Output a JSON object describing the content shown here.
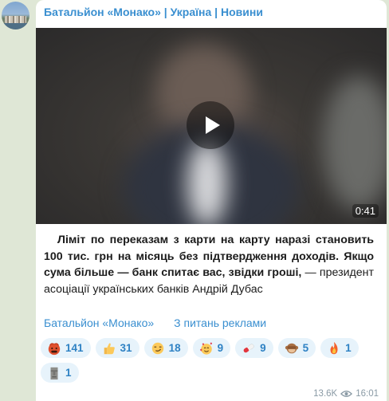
{
  "channel": {
    "title": "Батальйон «Монако» | Україна | Новини"
  },
  "video": {
    "duration": "0:41"
  },
  "post": {
    "caption_bold": "Ліміт по переказам з карти на карту наразі становить 100 тис. грн на місяць без підтвердження доходів. Якщо сума більше — банк спитає вас, звідки гроші,",
    "caption_rest": " — президент асоціації українських банків Андрій Дубас"
  },
  "links": {
    "channel_link": "Батальйон «Монако»",
    "ads_link": "З питань реклами"
  },
  "reactions": [
    {
      "icon": "angry-face-icon",
      "count": "141"
    },
    {
      "icon": "thumbs-up-icon",
      "count": "31"
    },
    {
      "icon": "smirking-face-icon",
      "count": "18"
    },
    {
      "icon": "hearts-face-icon",
      "count": "9"
    },
    {
      "icon": "pill-icon",
      "count": "9"
    },
    {
      "icon": "see-no-evil-monkey-icon",
      "count": "5"
    },
    {
      "icon": "fire-icon",
      "count": "1"
    },
    {
      "icon": "moai-icon",
      "count": "1"
    }
  ],
  "meta": {
    "views": "13.6K",
    "time": "16:01"
  }
}
